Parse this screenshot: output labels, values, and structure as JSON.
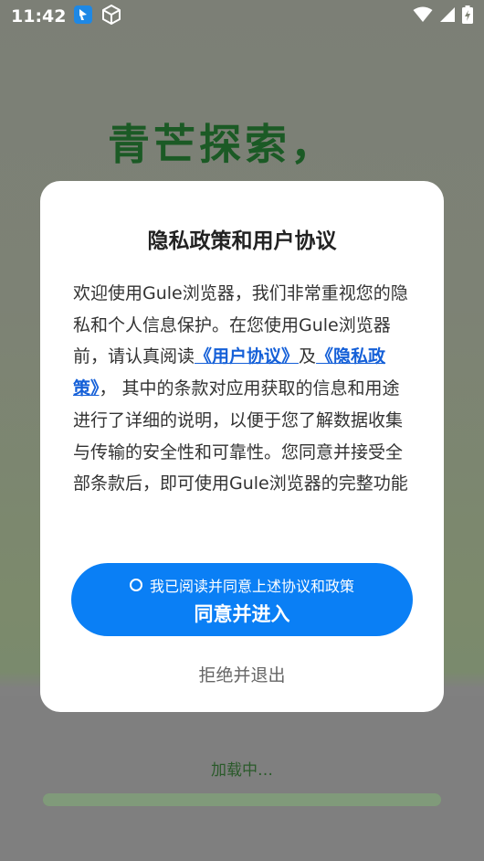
{
  "status_bar": {
    "time": "11:42"
  },
  "background": {
    "slogan": "青芒探索，",
    "loading_text": "加载中…",
    "loading_progress": 1.0
  },
  "dialog": {
    "title": "隐私政策和用户协议",
    "body_part1": "欢迎使用Gule浏览器，我们非常重视您的隐私和个人信息保护。在您使用Gule浏览器前，请认真阅读",
    "link_user_agreement": "《用户协议》",
    "body_and": "及",
    "link_privacy_policy": "《隐私政策》",
    "body_part2": "， 其中的条款对应用获取的信息和用途进行了详细的说明，以便于您了解数据收集与传输的安全性和可靠性。您同意并接受全部条款后，即可使用Gule浏览器的完整功能",
    "checkbox_label": "我已阅读并同意上述协议和政策",
    "agree_button": "同意并进入",
    "reject_button": "拒绝并退出"
  },
  "colors": {
    "accent": "#0a7ff5",
    "link": "#1560d8",
    "slogan": "#1b5a25"
  }
}
